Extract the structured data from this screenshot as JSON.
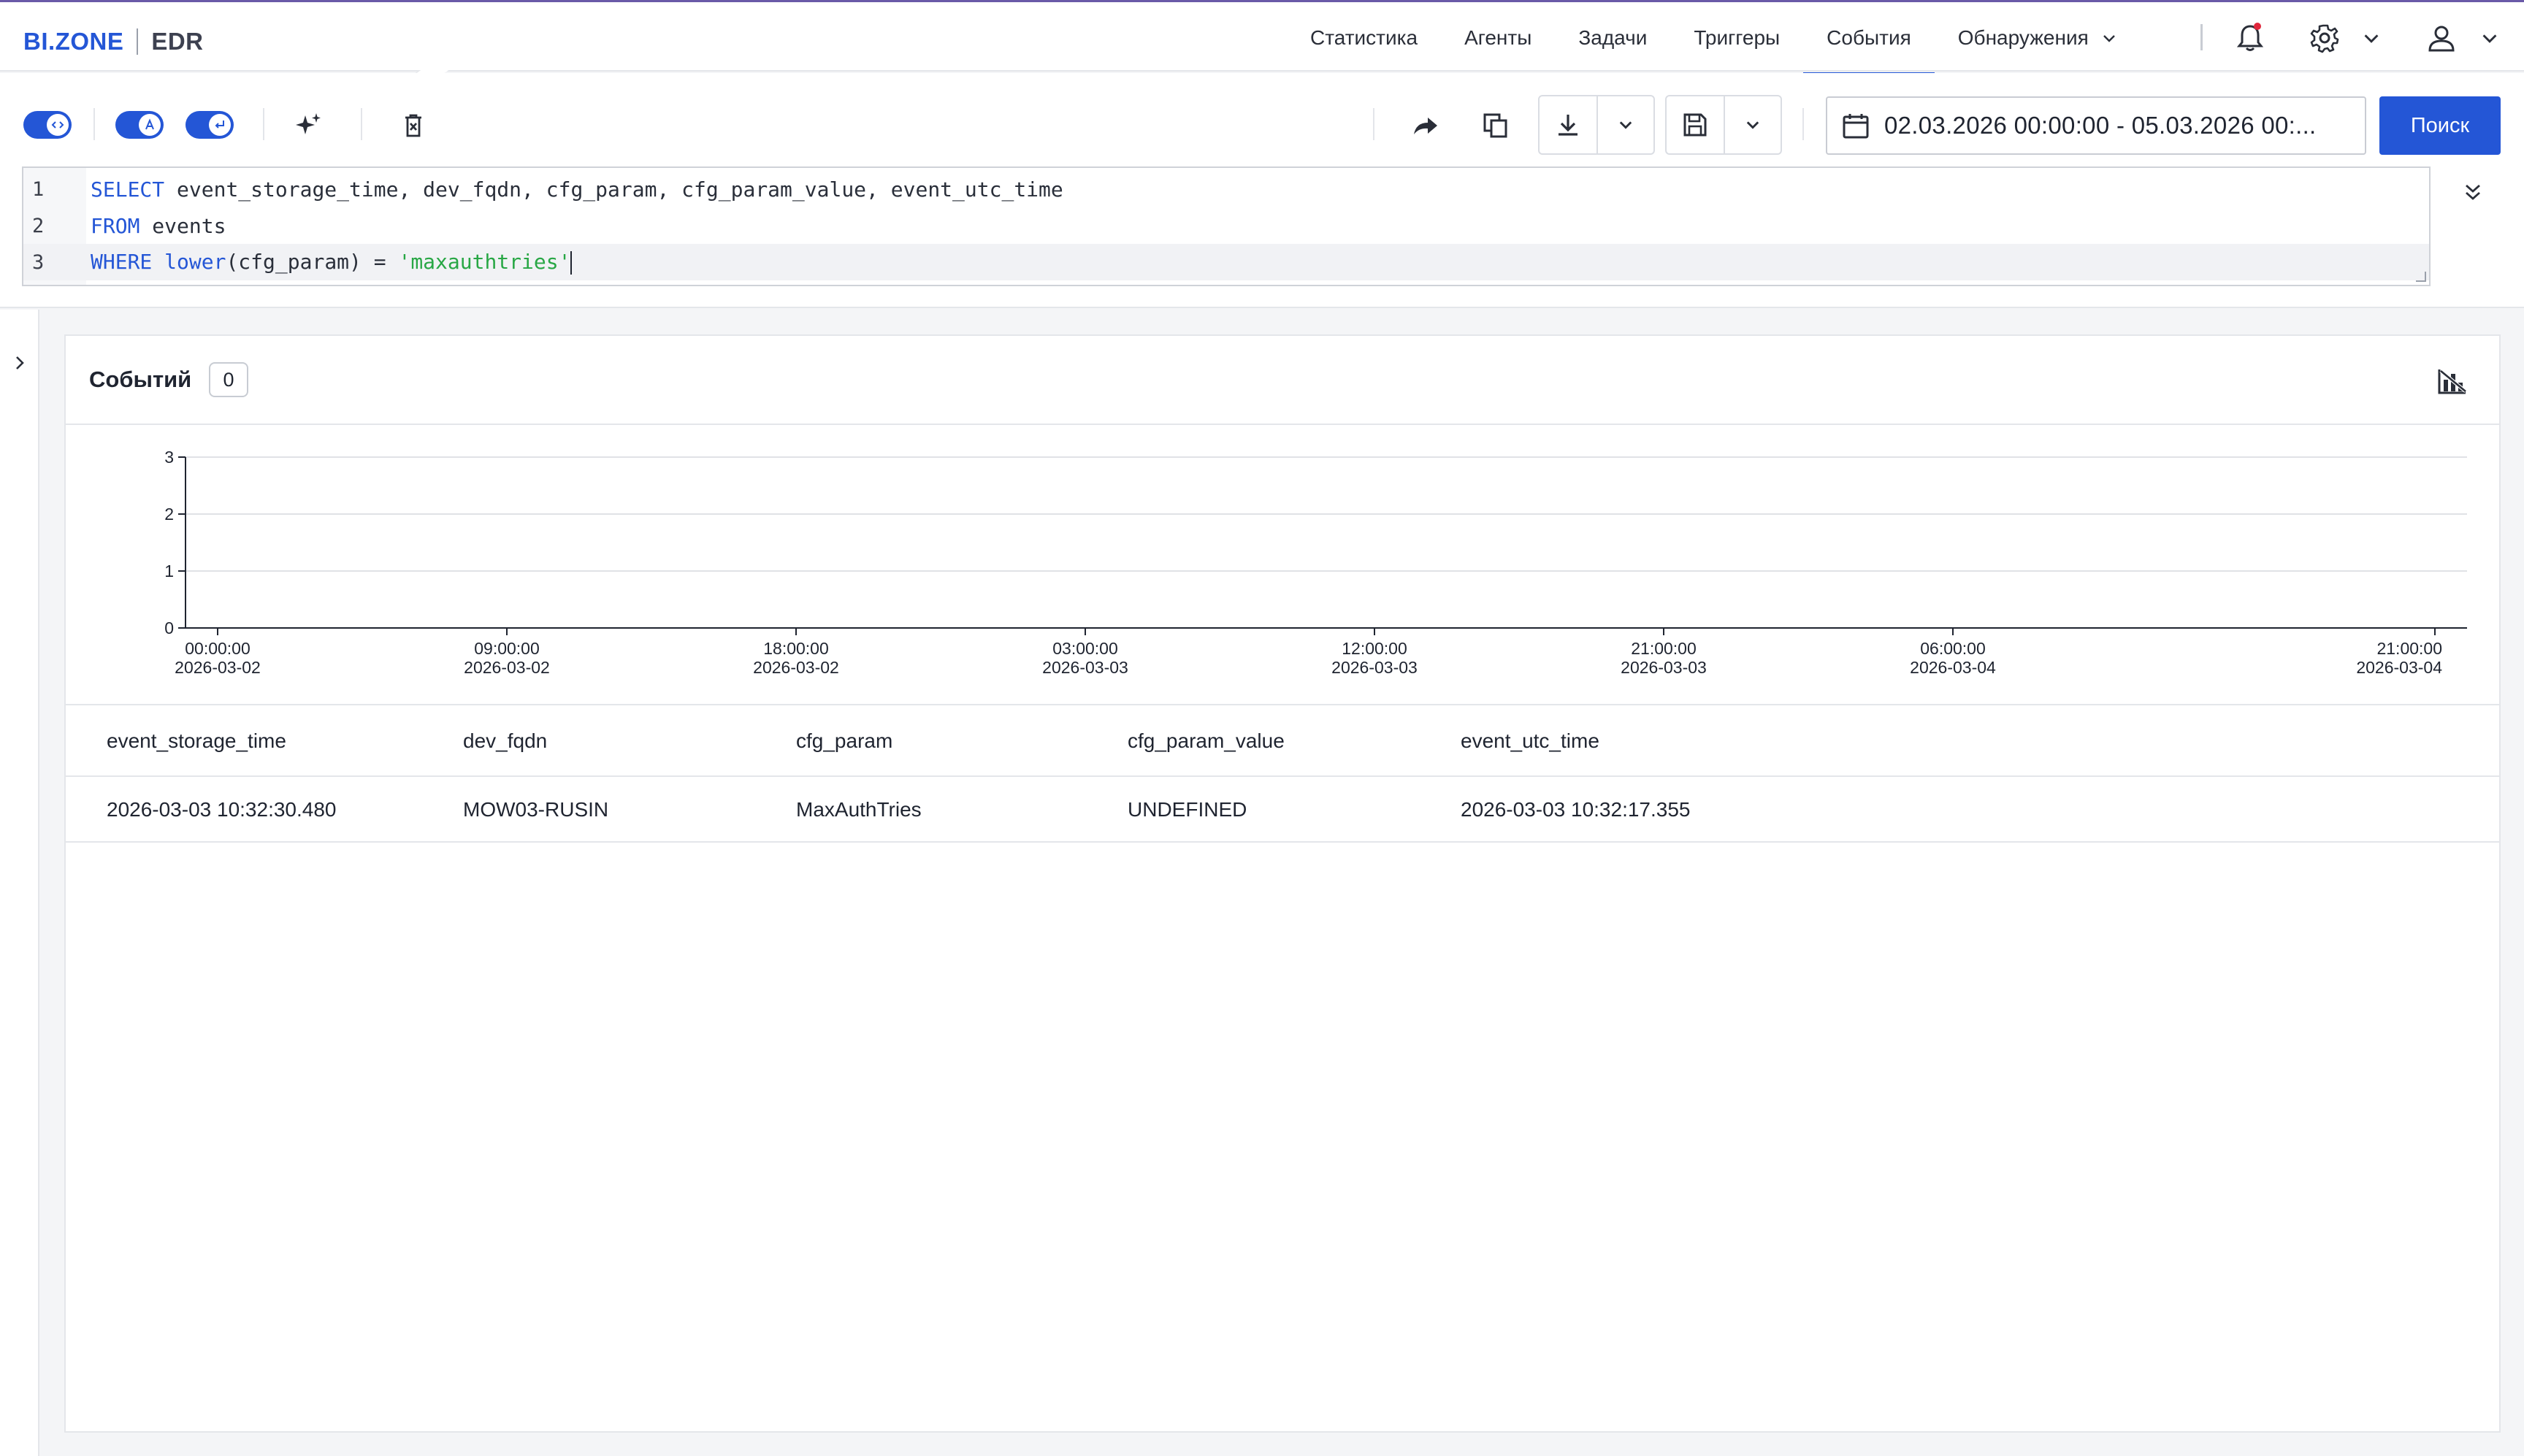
{
  "brand": {
    "left": "BI.ZONE",
    "right": "EDR"
  },
  "nav": {
    "items": [
      "Статистика",
      "Агенты",
      "Задачи",
      "Триггеры",
      "События",
      "Обнаружения"
    ],
    "active": "События"
  },
  "toolbar": {
    "date_range": "02.03.2026 00:00:00 - 05.03.2026 00:...",
    "search_label": "Поиск"
  },
  "query": {
    "lines": [
      {
        "num": "1",
        "kw": "SELECT",
        "rest": " event_storage_time, dev_fqdn, cfg_param, cfg_param_value, event_utc_time"
      },
      {
        "num": "2",
        "kw": "FROM",
        "rest": " events"
      },
      {
        "num": "3",
        "kw": "WHERE",
        "fn": " lower",
        "rest": "(cfg_param) = ",
        "str": "'maxauthtries'"
      }
    ]
  },
  "results": {
    "title": "Событий",
    "count": "0",
    "columns": [
      "event_storage_time",
      "dev_fqdn",
      "cfg_param",
      "cfg_param_value",
      "event_utc_time"
    ],
    "rows": [
      [
        "2026-03-03 10:32:30.480",
        "MOW03-RUSIN",
        "MaxAuthTries",
        "UNDEFINED",
        "2026-03-03 10:32:17.355"
      ]
    ]
  },
  "chart_data": {
    "type": "bar",
    "ylim": [
      0,
      3
    ],
    "yticks": [
      "0",
      "1",
      "2",
      "3"
    ],
    "xticks": [
      {
        "time": "00:00:00",
        "date": "2026-03-02",
        "hours": 0
      },
      {
        "time": "09:00:00",
        "date": "2026-03-02",
        "hours": 9
      },
      {
        "time": "18:00:00",
        "date": "2026-03-02",
        "hours": 18
      },
      {
        "time": "03:00:00",
        "date": "2026-03-03",
        "hours": 27
      },
      {
        "time": "12:00:00",
        "date": "2026-03-03",
        "hours": 36
      },
      {
        "time": "21:00:00",
        "date": "2026-03-03",
        "hours": 45
      },
      {
        "time": "06:00:00",
        "date": "2026-03-04",
        "hours": 54
      },
      {
        "time": "21:00:00",
        "date": "2026-03-04",
        "hours": 69
      }
    ],
    "x_range_hours": [
      -1,
      70
    ],
    "grid": true,
    "colors": {
      "accent": "#2456d6",
      "axis": "#1f2430",
      "grid": "#e0e2e6"
    }
  }
}
